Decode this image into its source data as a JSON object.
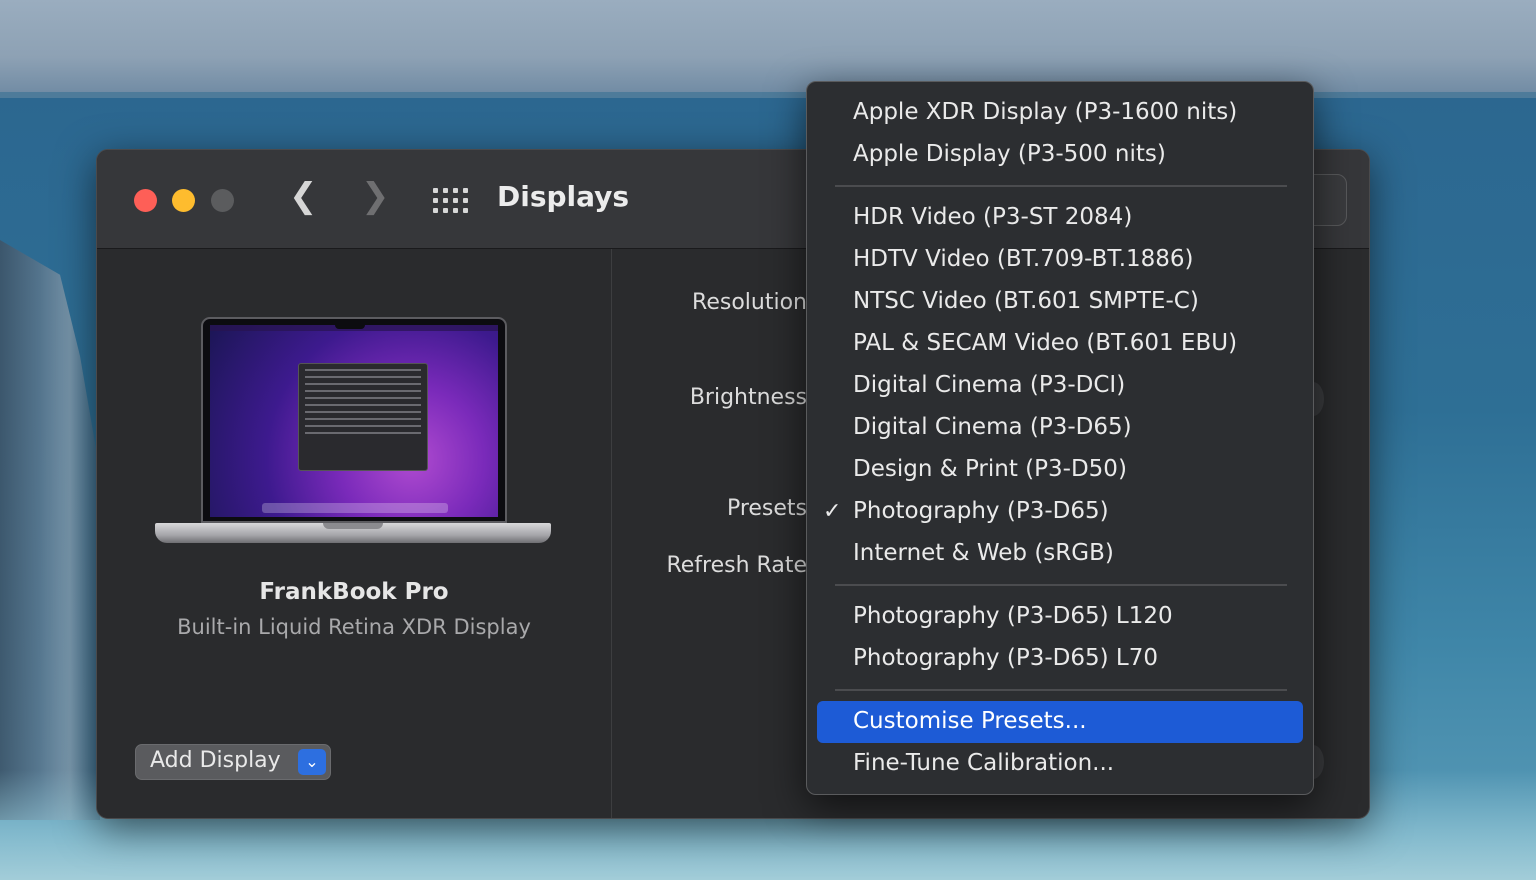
{
  "window": {
    "title": "Displays",
    "back_icon": "chevron-left-icon",
    "forward_icon": "chevron-right-icon",
    "grid_icon": "grid-icon"
  },
  "sidebar": {
    "device_name": "FrankBook Pro",
    "device_subtitle": "Built-in Liquid Retina XDR Display",
    "add_display_label": "Add Display"
  },
  "settings": {
    "resolution_label": "Resolution",
    "brightness_label": "Brightness",
    "presets_label": "Presets",
    "refresh_rate_label": "Refresh Rate"
  },
  "presets_menu": {
    "selected": "Photography (P3-D65)",
    "highlighted": "Customise Presets...",
    "groups": [
      [
        "Apple XDR Display (P3-1600 nits)",
        "Apple Display (P3-500 nits)"
      ],
      [
        "HDR Video (P3-ST 2084)",
        "HDTV Video (BT.709-BT.1886)",
        "NTSC Video (BT.601 SMPTE-C)",
        "PAL & SECAM Video (BT.601 EBU)",
        "Digital Cinema (P3-DCI)",
        "Digital Cinema (P3-D65)",
        "Design & Print (P3-D50)",
        "Photography (P3-D65)",
        "Internet & Web (sRGB)"
      ],
      [
        "Photography (P3-D65) L120",
        "Photography (P3-D65) L70"
      ],
      [
        "Customise Presets...",
        "Fine-Tune Calibration..."
      ]
    ]
  },
  "colors": {
    "accent": "#1d5bd6",
    "traffic_red": "#fe5f57",
    "traffic_yellow": "#febc2e"
  }
}
